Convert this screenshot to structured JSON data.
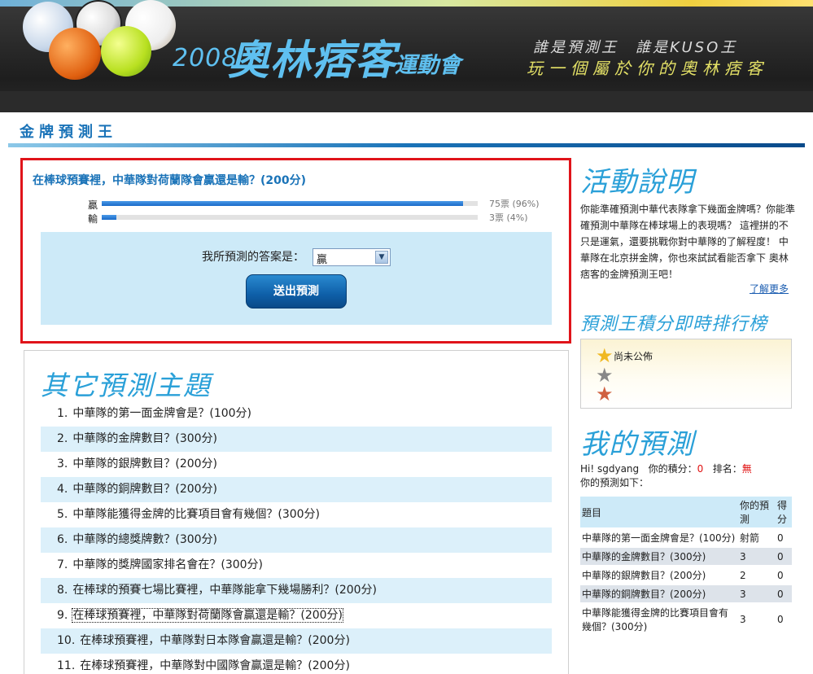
{
  "banner": {
    "year": "2008",
    "title": "奧林痞客",
    "subtitle": "運動會",
    "slogan_line1": "誰是預測王　誰是KUSO王",
    "slogan_line2": "玩一個屬於你的奧林痞客"
  },
  "section_title": "金牌預測王",
  "poll": {
    "question": "在棒球預賽裡，中華隊對荷蘭隊會贏還是輸？(200分)",
    "options": [
      {
        "label": "贏",
        "fraction": 0.96,
        "count_text": "75票 (96%)"
      },
      {
        "label": "輸",
        "fraction": 0.04,
        "count_text": "3票 (4%)"
      }
    ],
    "form_label": "我所預測的答案是：",
    "selected_value": "贏",
    "submit_label": "送出預測"
  },
  "topics": {
    "title": "其它預測主題",
    "items": [
      {
        "num": "1.",
        "text": "中華隊的第一面金牌會是？(100分)"
      },
      {
        "num": "2.",
        "text": "中華隊的金牌數目？(300分)"
      },
      {
        "num": "3.",
        "text": "中華隊的銀牌數目？(200分)"
      },
      {
        "num": "4.",
        "text": "中華隊的銅牌數目？(200分)"
      },
      {
        "num": "5.",
        "text": "中華隊能獲得金牌的比賽項目會有幾個？(300分)"
      },
      {
        "num": "6.",
        "text": "中華隊的總獎牌數？(300分)"
      },
      {
        "num": "7.",
        "text": "中華隊的獎牌國家排名會在？(300分)"
      },
      {
        "num": "8.",
        "text": "在棒球的預賽七場比賽裡，中華隊能拿下幾場勝利？(200分)"
      },
      {
        "num": "9.",
        "text": "在棒球預賽裡，中華隊對荷蘭隊會贏還是輸？(200分)"
      },
      {
        "num": "10.",
        "text": "在棒球預賽裡，中華隊對日本隊會贏還是輸？(200分)"
      },
      {
        "num": "11.",
        "text": "在棒球預賽裡，中華隊對中國隊會贏還是輸？(200分)"
      }
    ]
  },
  "description": {
    "title": "活動說明",
    "text": "你能準確預測中華代表隊拿下幾面金牌嗎？你能準確預測中華隊在棒球場上的表現嗎？ 這裡拼的不只是運氣，還要挑戰你對中華隊的了解程度！ 中華隊在北京拼金牌，你也來試試看能否拿下 奧林痞客的金牌預測王吧！",
    "more_link": "了解更多"
  },
  "ranking": {
    "title": "預測王積分即時排行榜",
    "status": "尚未公佈",
    "stars": [
      "★",
      "★",
      "★"
    ]
  },
  "my_predictions": {
    "title": "我的預測",
    "greeting": "Hi! sgdyang",
    "score_label": "你的積分：",
    "score_value": "0",
    "rank_label": "排名：",
    "rank_value": "無",
    "list_label": "你的預測如下：",
    "headers": [
      "題目",
      "你的預測",
      "得分"
    ],
    "rows": [
      [
        "中華隊的第一面金牌會是？(100分)",
        "射箭",
        "0"
      ],
      [
        "中華隊的金牌數目？(300分)",
        "3",
        "0"
      ],
      [
        "中華隊的銀牌數目？(200分)",
        "2",
        "0"
      ],
      [
        "中華隊的銅牌數目？(200分)",
        "3",
        "0"
      ],
      [
        "中華隊能獲得金牌的比賽項目會有幾個？(300分)",
        "3",
        "0"
      ]
    ]
  }
}
